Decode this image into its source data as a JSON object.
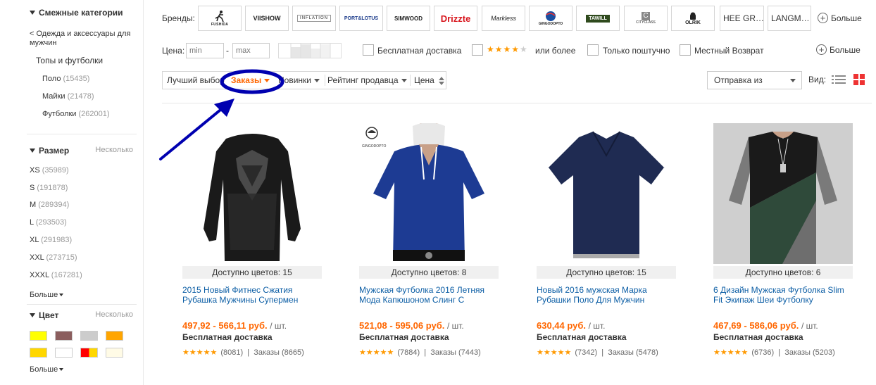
{
  "sidebar": {
    "related_title": "Смежные категории",
    "parent_link": "< Одежда и аксессуары для мужчин",
    "category": "Топы и футболки",
    "subcats": [
      {
        "name": "Поло",
        "count": "(15435)"
      },
      {
        "name": "Майки",
        "count": "(21478)"
      },
      {
        "name": "Футболки",
        "count": "(262001)"
      }
    ],
    "size_title": "Размер",
    "size_multi": "Несколько",
    "sizes": [
      {
        "name": "XS",
        "count": "(35989)"
      },
      {
        "name": "S",
        "count": "(191878)"
      },
      {
        "name": "M",
        "count": "(289394)"
      },
      {
        "name": "L",
        "count": "(293503)"
      },
      {
        "name": "XL",
        "count": "(291983)"
      },
      {
        "name": "XXL",
        "count": "(273715)"
      },
      {
        "name": "XXXL",
        "count": "(167281)"
      }
    ],
    "more": "Больше",
    "color_title": "Цвет",
    "color_multi": "Несколько",
    "swatches": [
      "#ffff00",
      "#8b5e5e",
      "#cccccc",
      "#ffa500",
      "#ffd700",
      "#ffffff",
      "#ff0000",
      "#fffbe6"
    ]
  },
  "brands": {
    "label": "Бренды:",
    "items": [
      "FUSHIDA",
      "VIISHOW",
      "INFLATION",
      "PORT&LOTUS",
      "SIMWOOD",
      "Drizzte",
      "Markless",
      "GINGODOPTO",
      "TAWILL",
      "CITYCLASS",
      "OLRIK",
      "HEE GR…",
      "LANGM…"
    ],
    "more": "Больше"
  },
  "filters": {
    "price_label": "Цена:",
    "min_placeholder": "min",
    "dash": "-",
    "max_placeholder": "max",
    "free_shipping": "Бесплатная доставка",
    "rating_stars": "★★★★★",
    "rating_suffix": "или более",
    "single_only": "Только поштучно",
    "local_return": "Местный Возврат",
    "more": "Больше"
  },
  "sort": {
    "best": "Лучший выбор",
    "orders": "Заказы",
    "new": "Новинки",
    "seller_rating": "Рейтинг продавца",
    "price": "Цена",
    "ship_from": "Отправка из",
    "view_label": "Вид:"
  },
  "colors": {
    "orders_active": "#f60",
    "price": "#f60",
    "link": "#0c5ea5",
    "annotation": "#0000b0"
  },
  "products": [
    {
      "colors": "Доступно цветов: 15",
      "title": "2015 Новый Фитнес Сжатия Рубашка Мужчины Супермен",
      "price": "497,92 - 566,11 руб.",
      "unit": "/ шт.",
      "shipping": "Бесплатная доставка",
      "rating": 5,
      "reviews": "(8081)",
      "orders": "Заказы (8665)"
    },
    {
      "colors": "Доступно цветов: 8",
      "title": "Мужская Футболка 2016 Летняя Мода Капюшоном Слинг С",
      "price": "521,08 - 595,06 руб.",
      "unit": "/ шт.",
      "shipping": "Бесплатная доставка",
      "rating": 5,
      "reviews": "(7884)",
      "orders": "Заказы (7443)"
    },
    {
      "colors": "Доступно цветов: 15",
      "title": "Новый 2016 мужская Марка Рубашки Поло Для Мужчин",
      "price": "630,44 руб.",
      "unit": "/ шт.",
      "shipping": "Бесплатная доставка",
      "rating": 5,
      "reviews": "(7342)",
      "orders": "Заказы (5478)"
    },
    {
      "colors": "Доступно цветов: 6",
      "title": "6 Дизайн Мужская Футболка Slim Fit Экипаж Шеи Футболку",
      "price": "467,69 - 586,06 руб.",
      "unit": "/ шт.",
      "shipping": "Бесплатная доставка",
      "rating": 5,
      "reviews": "(6736)",
      "orders": "Заказы (5203)"
    }
  ]
}
